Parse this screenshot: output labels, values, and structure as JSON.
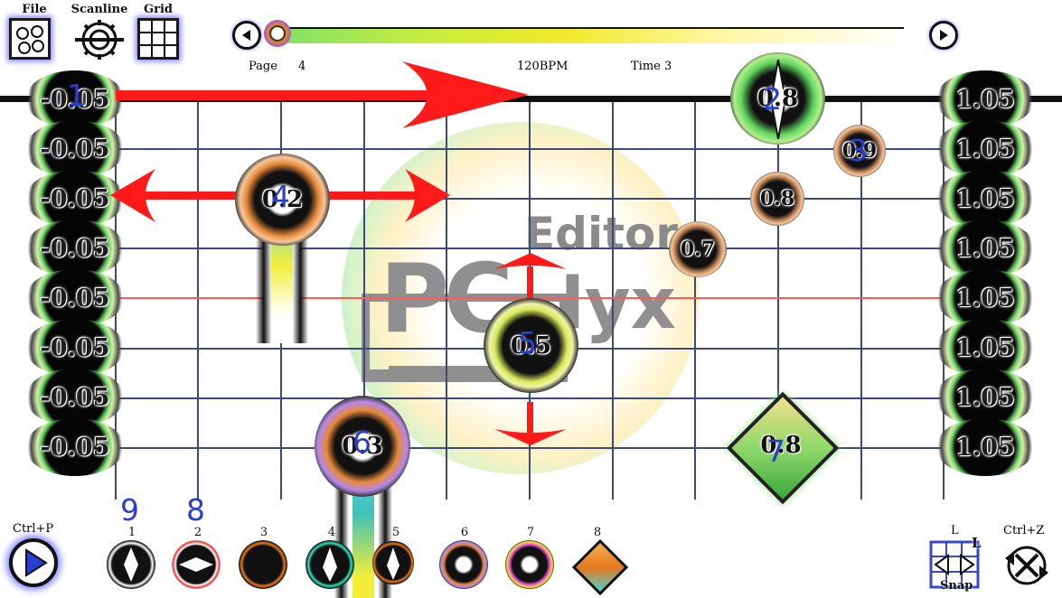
{
  "toolbar": {
    "file_label": "File",
    "scanline_label": "Scanline",
    "grid_label": "Grid"
  },
  "header": {
    "page_label": "Page",
    "page_number": "4",
    "bpm": "120BPM",
    "time": "Time 3"
  },
  "watermark": {
    "line1": "Editor",
    "line2": "PC",
    "line3": "lyx"
  },
  "left_column_values": [
    "-0.05",
    "-0.05",
    "-0.05",
    "-0.05",
    "-0.05",
    "-0.05",
    "-0.05",
    "-0.05"
  ],
  "right_column_values": [
    "1.05",
    "1.05",
    "1.05",
    "1.05",
    "1.05",
    "1.05",
    "1.05",
    "1.05"
  ],
  "notes": [
    {
      "id": "n1",
      "value": "-0.05",
      "marker": "1"
    },
    {
      "id": "n2",
      "value": "0.8",
      "marker": "2"
    },
    {
      "id": "n3",
      "value": "0.9",
      "marker": "3"
    },
    {
      "id": "n4",
      "value": "0.2",
      "marker": "4"
    },
    {
      "id": "n5",
      "value": "0.5",
      "marker": "5"
    },
    {
      "id": "n6",
      "value": "0.3",
      "marker": "6"
    },
    {
      "id": "n7",
      "value": "0.8",
      "marker": "7"
    },
    {
      "id": "n8",
      "value": "0.8"
    },
    {
      "id": "n9",
      "value": "0.7"
    }
  ],
  "annotations": {
    "nine": "9",
    "eight": "8"
  },
  "bottom": {
    "play_shortcut": "Ctrl+P",
    "palette_labels": [
      "1",
      "2",
      "3",
      "4",
      "5",
      "6",
      "7",
      "8"
    ],
    "snap_shortcut": "L",
    "snap_label": "Snap",
    "snap_badge": "L",
    "undo_shortcut": "Ctrl+Z"
  },
  "colors": {
    "grid": "#3d4a78",
    "arrow": "#ff1a1a",
    "annotation": "#2a3ed0"
  }
}
